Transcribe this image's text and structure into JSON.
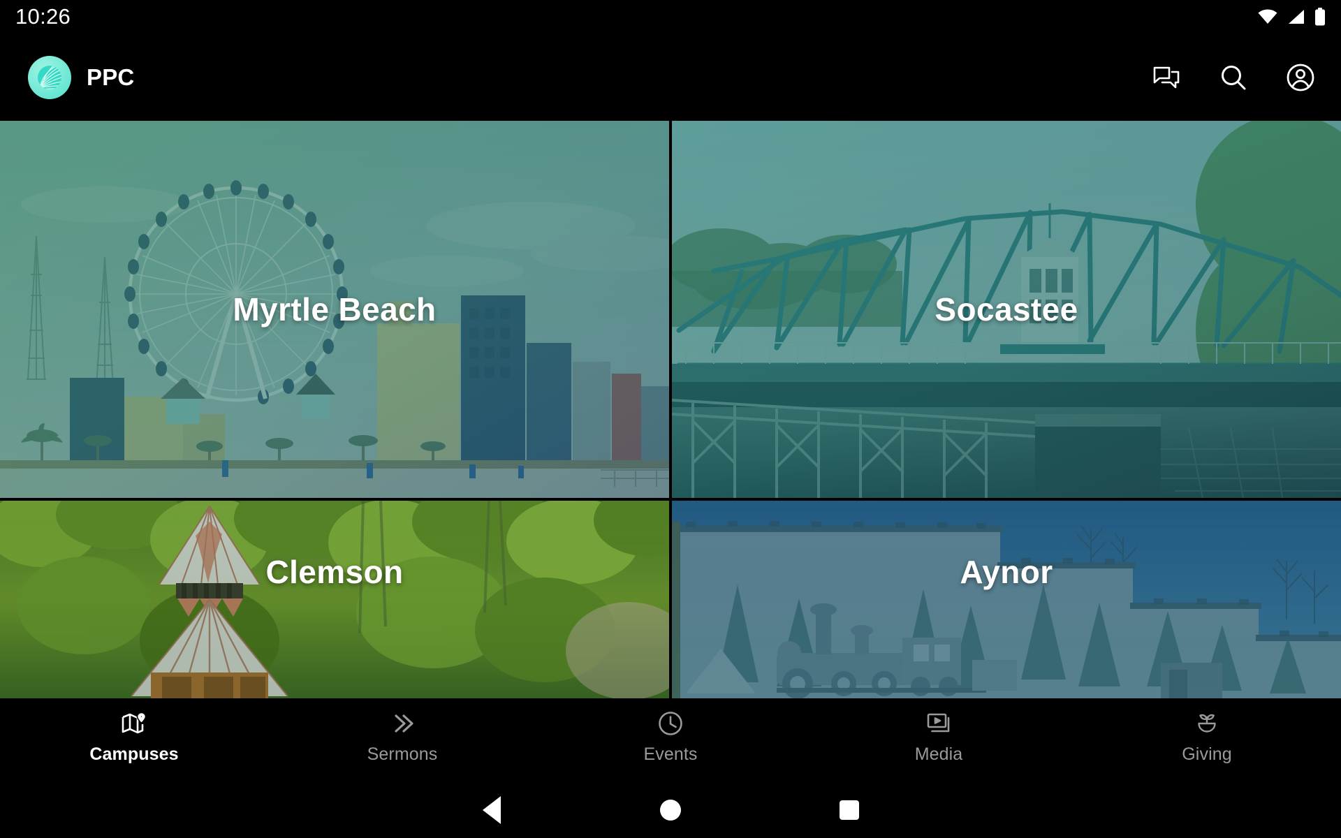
{
  "status_bar": {
    "clock": "10:26",
    "icons": [
      "wifi-icon",
      "cellular-signal-icon",
      "battery-full-icon"
    ]
  },
  "app_bar": {
    "logo_icon": "ppc-shell-logo-icon",
    "title": "PPC",
    "actions": [
      {
        "name": "chat-icon",
        "label": "Chat"
      },
      {
        "name": "search-icon",
        "label": "Search"
      },
      {
        "name": "account-circle-icon",
        "label": "Account"
      }
    ]
  },
  "campuses": [
    {
      "name": "Myrtle Beach",
      "image": "ferris-wheel-and-beachfront-skyline",
      "tint": "#3f7a64"
    },
    {
      "name": "Socastee",
      "image": "steel-truss-swing-bridge-over-water",
      "tint": "#2f7f7a"
    },
    {
      "name": "Clemson",
      "image": "gazebo-tower-in-green-forest",
      "tint": "#2f6a2c"
    },
    {
      "name": "Aynor",
      "image": "train-mural-on-building-wall",
      "tint": "#24566e"
    }
  ],
  "tabs": [
    {
      "label": "Campuses",
      "icon": "map-pin-icon",
      "active": true
    },
    {
      "label": "Sermons",
      "icon": "double-chevron-right-icon",
      "active": false
    },
    {
      "label": "Events",
      "icon": "clock-icon",
      "active": false
    },
    {
      "label": "Media",
      "icon": "video-library-icon",
      "active": false
    },
    {
      "label": "Giving",
      "icon": "seedling-bowl-icon",
      "active": false
    }
  ],
  "system_nav": {
    "back": "back-button",
    "home": "home-button",
    "recents": "recents-button"
  },
  "colors": {
    "background": "#000000",
    "accent": "#6fe8d6",
    "active_tab": "#ffffff",
    "inactive_tab": "#9a9a9a"
  }
}
